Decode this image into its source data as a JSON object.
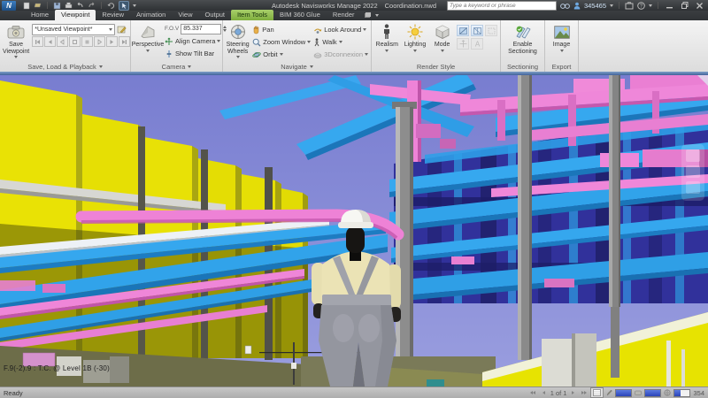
{
  "title_bar": {
    "app_title": "Autodesk Navisworks Manage 2022",
    "document_name": "Coordination.nwd",
    "search_placeholder": "Type a keyword or phrase",
    "account_id": "345465"
  },
  "tabs": [
    {
      "label": "Home"
    },
    {
      "label": "Viewpoint",
      "active": true
    },
    {
      "label": "Review"
    },
    {
      "label": "Animation"
    },
    {
      "label": "View"
    },
    {
      "label": "Output"
    },
    {
      "label": "Item Tools",
      "contextual": true
    },
    {
      "label": "BIM 360 Glue"
    },
    {
      "label": "Render"
    }
  ],
  "ribbon": {
    "save_group": {
      "label": "Save, Load & Playback",
      "save_viewpoint": "Save Viewpoint",
      "viewpoint_dropdown": "*Unsaved Viewpoint*"
    },
    "camera_group": {
      "label": "Camera",
      "perspective": "Perspective",
      "fov_label": "F.O.V",
      "fov_value": "85.337",
      "align_camera": "Align Camera",
      "show_tilt_bar": "Show Tilt Bar"
    },
    "navigate_group": {
      "label": "Navigate",
      "steering_wheels": "Steering Wheels",
      "pan": "Pan",
      "zoom_window": "Zoom Window",
      "orbit": "Orbit",
      "look_around": "Look Around",
      "walk": "Walk",
      "threedconnexion": "3Dconnexion"
    },
    "render_group": {
      "label": "Render Style",
      "realism": "Realism",
      "lighting": "Lighting",
      "mode": "Mode"
    },
    "sectioning_group": {
      "label": "Sectioning",
      "enable_sectioning": "Enable Sectioning"
    },
    "export_group": {
      "label": "Export",
      "image": "Image"
    }
  },
  "viewport": {
    "overlay_text": "F.9(-2).9 : T.C. @ Level 1B (-30)"
  },
  "status_bar": {
    "status": "Ready",
    "sheet_indicator": "1 of 1",
    "memory_value": "354"
  },
  "colors": {
    "titlebar_bg": "#35383b",
    "contextual_tab_green": "#7fae3e",
    "ribbon_bg": "#e8e8e8",
    "accent_strip_blue": "#41639a",
    "status_bg": "#b5b5b5",
    "scene": {
      "sky": "#7c81d3",
      "wall_yellow": "#e8e205",
      "pipe_cyan": "#35a7ee",
      "duct_pink": "#ef86d8",
      "steel_gray": "#8d8d8d",
      "rack_navy": "#31319b",
      "avatar_overalls": "#94969f",
      "avatar_shirt": "#ebe3b5",
      "hard_hat": "#f7f7f3"
    }
  }
}
